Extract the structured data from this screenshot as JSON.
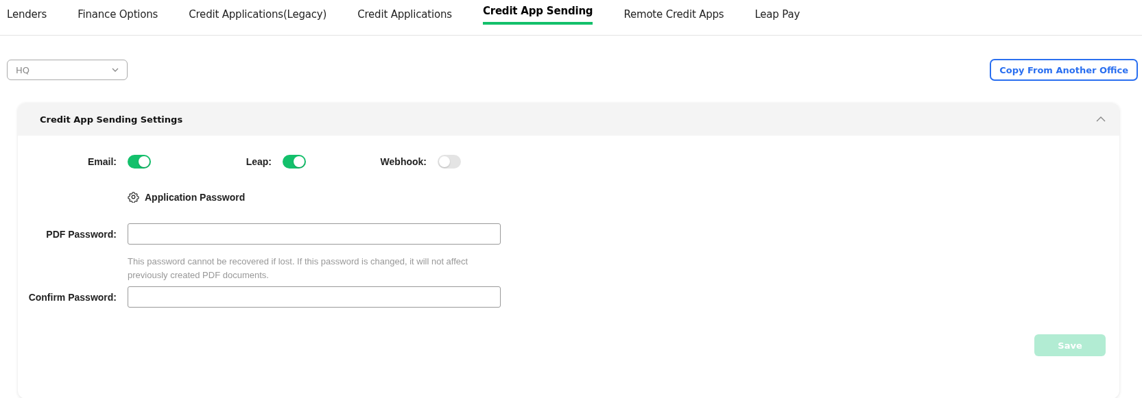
{
  "tabs": [
    {
      "label": "Lenders",
      "selected": false
    },
    {
      "label": "Finance Options",
      "selected": false
    },
    {
      "label": "Credit Applications(Legacy)",
      "selected": false
    },
    {
      "label": "Credit Applications",
      "selected": false
    },
    {
      "label": "Credit App Sending",
      "selected": true
    },
    {
      "label": "Remote Credit Apps",
      "selected": false
    },
    {
      "label": "Leap Pay",
      "selected": false
    }
  ],
  "office_select": {
    "value": "HQ"
  },
  "copy_button": "Copy From Another Office",
  "panel": {
    "title": "Credit App Sending Settings",
    "expanded": true,
    "toggles": [
      {
        "label": "Email:",
        "on": true
      },
      {
        "label": "Leap:",
        "on": true
      },
      {
        "label": "Webhook:",
        "on": false
      }
    ],
    "section_title": "Application Password",
    "pdf_password": {
      "label": "PDF Password:"
    },
    "hint": "This password cannot be recovered if lost. If this password is changed, it will not affect previously created PDF documents.",
    "confirm_password": {
      "label": "Confirm Password:"
    },
    "save_button": {
      "label": "Save",
      "disabled": true
    }
  }
}
